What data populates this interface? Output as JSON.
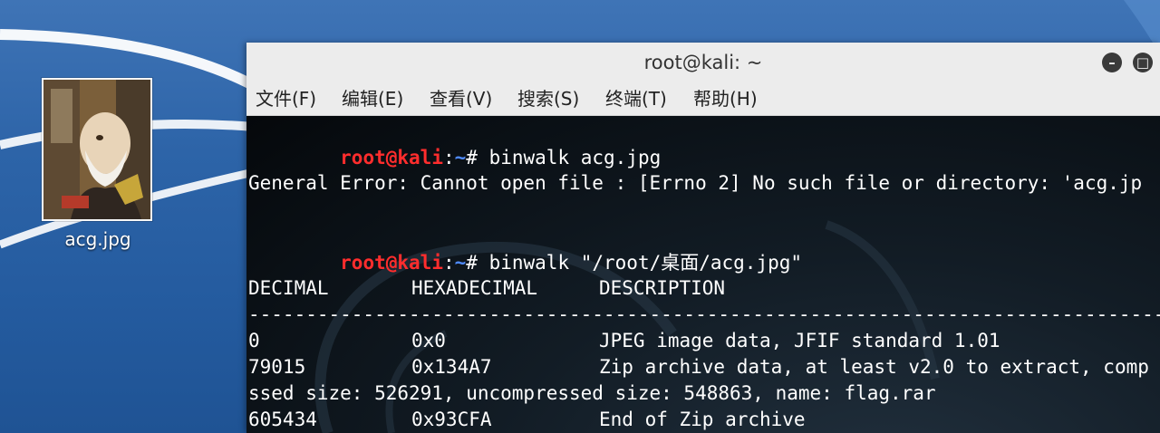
{
  "desktop": {
    "icon_label": "acg.jpg"
  },
  "terminal": {
    "title": "root@kali: ~",
    "menu": [
      "文件(F)",
      "编辑(E)",
      "查看(V)",
      "搜索(S)",
      "终端(T)",
      "帮助(H)"
    ],
    "prompt": {
      "user": "root",
      "at": "@",
      "host": "kali",
      "colon": ":",
      "path": "~",
      "symbol": "#"
    },
    "lines": {
      "cmd1": " binwalk acg.jpg",
      "error": "General Error: Cannot open file : [Errno 2] No such file or directory: 'acg.jp",
      "cmd2": " binwalk \"/root/桌面/acg.jpg\"",
      "separator": "----------------------------------------------------------------------------------------------------"
    },
    "table": {
      "headers": [
        "DECIMAL",
        "HEXADECIMAL",
        "DESCRIPTION"
      ],
      "rows": [
        {
          "decimal": "0",
          "hex": "0x0",
          "desc": "JPEG image data, JFIF standard 1.01"
        },
        {
          "decimal": "79015",
          "hex": "0x134A7",
          "desc": "Zip archive data, at least v2.0 to extract, comp"
        },
        {
          "wrap": "ssed size: 526291, uncompressed size: 548863, name: flag.rar"
        },
        {
          "decimal": "605434",
          "hex": "0x93CFA",
          "desc": "End of Zip archive"
        }
      ]
    }
  },
  "colors": {
    "prompt_user": "#ff2d2d",
    "prompt_path": "#4f8bff",
    "terminal_bg": "#05080b",
    "titlebar_bg": "#ececec",
    "desktop_bg": "#2d64a8"
  }
}
